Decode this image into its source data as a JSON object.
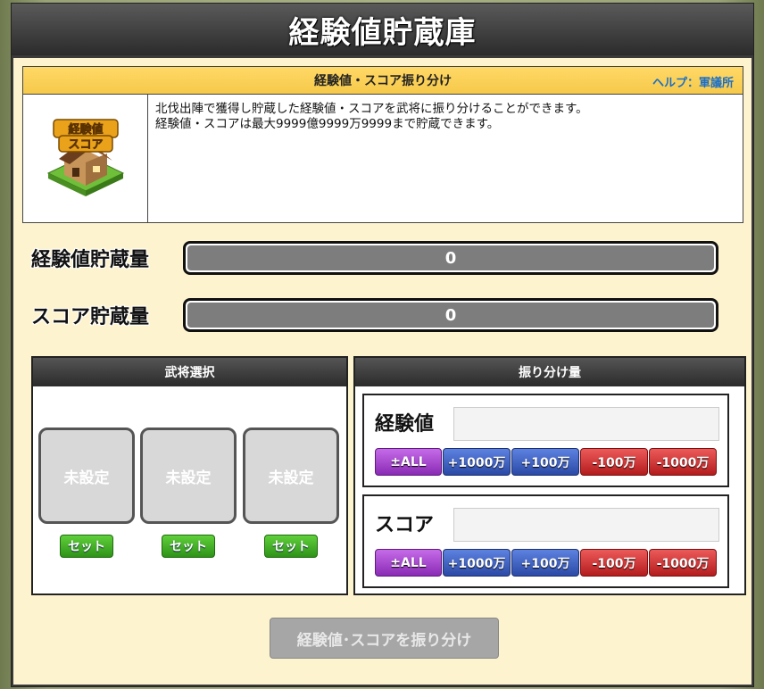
{
  "window": {
    "title": "経験値貯蔵庫"
  },
  "info": {
    "header": "経験値・スコア振り分け",
    "help_link": "ヘルプ：軍議所",
    "icon_name": "storehouse-icon",
    "icon_text": "経験値スコア",
    "line1": "北伐出陣で獲得し貯蔵した経験値・スコアを武将に振り分けることができます。",
    "line2": "経験値・スコアは最大9999億9999万9999まで貯蔵できます。"
  },
  "storage": {
    "exp_label": "経験値貯蔵量",
    "exp_value": "0",
    "score_label": "スコア貯蔵量",
    "score_value": "0"
  },
  "general_select": {
    "header": "武将選択",
    "slots": [
      {
        "label": "未設定",
        "button": "セット"
      },
      {
        "label": "未設定",
        "button": "セット"
      },
      {
        "label": "未設定",
        "button": "セット"
      }
    ]
  },
  "distribution": {
    "header": "振り分け量",
    "exp": {
      "label": "経験値",
      "value": "",
      "buttons": [
        "±ALL",
        "+1000万",
        "+100万",
        "-100万",
        "-1000万"
      ]
    },
    "score": {
      "label": "スコア",
      "value": "",
      "buttons": [
        "±ALL",
        "+1000万",
        "+100万",
        "-100万",
        "-1000万"
      ]
    }
  },
  "submit_label": "経験値･スコアを振り分け",
  "colors": {
    "header_yellow": "#f6c94a",
    "panel_bg": "#fdf4cf",
    "help_blue": "#1a6fc9",
    "set_green": "#2e9318",
    "all_purple": "#8a2bb5",
    "plus_blue": "#2b49a6",
    "minus_red": "#b41c1c"
  }
}
